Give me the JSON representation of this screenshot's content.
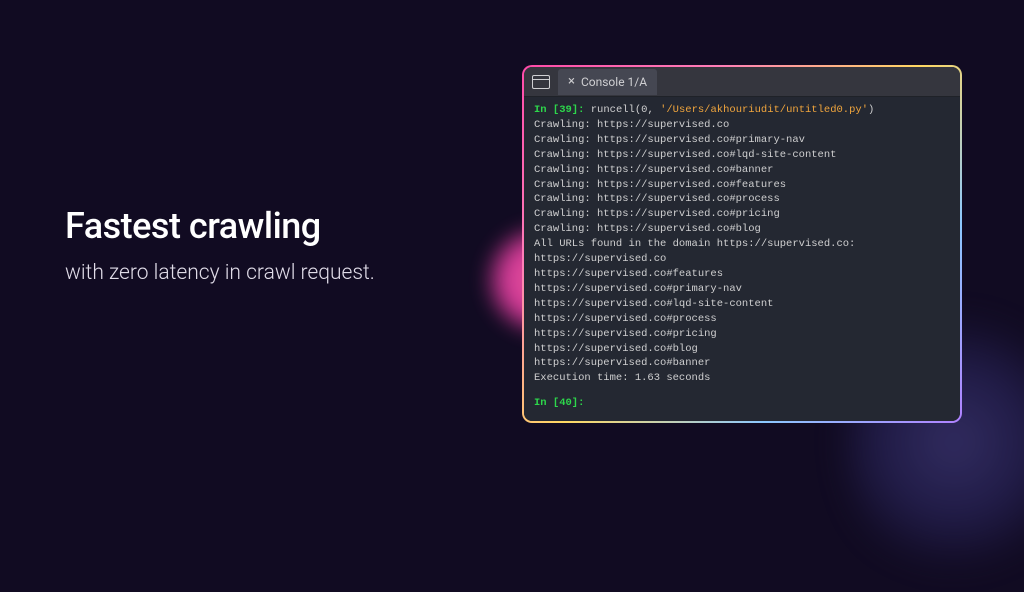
{
  "bg": {
    "base": "#110b22"
  },
  "headline": {
    "title": "Fastest crawling",
    "subtitle": "with zero latency in crawl request."
  },
  "console": {
    "tab_label": "Console 1/A",
    "prompt_in_open": "In [39]:",
    "cmd_prefix": "runcell(",
    "cmd_arg0": "0",
    "cmd_sep": ", ",
    "cmd_path": "'/Users/akhouriudit/untitled0.py'",
    "cmd_close": ")",
    "output_lines": [
      "Crawling: https://supervised.co",
      "Crawling: https://supervised.co#primary-nav",
      "Crawling: https://supervised.co#lqd-site-content",
      "Crawling: https://supervised.co#banner",
      "Crawling: https://supervised.co#features",
      "Crawling: https://supervised.co#process",
      "Crawling: https://supervised.co#pricing",
      "Crawling: https://supervised.co#blog",
      "All URLs found in the domain https://supervised.co:",
      "https://supervised.co",
      "https://supervised.co#features",
      "https://supervised.co#primary-nav",
      "https://supervised.co#lqd-site-content",
      "https://supervised.co#process",
      "https://supervised.co#pricing",
      "https://supervised.co#blog",
      "https://supervised.co#banner",
      "Execution time: 1.63 seconds"
    ],
    "prompt_in_next": "In [40]:"
  }
}
